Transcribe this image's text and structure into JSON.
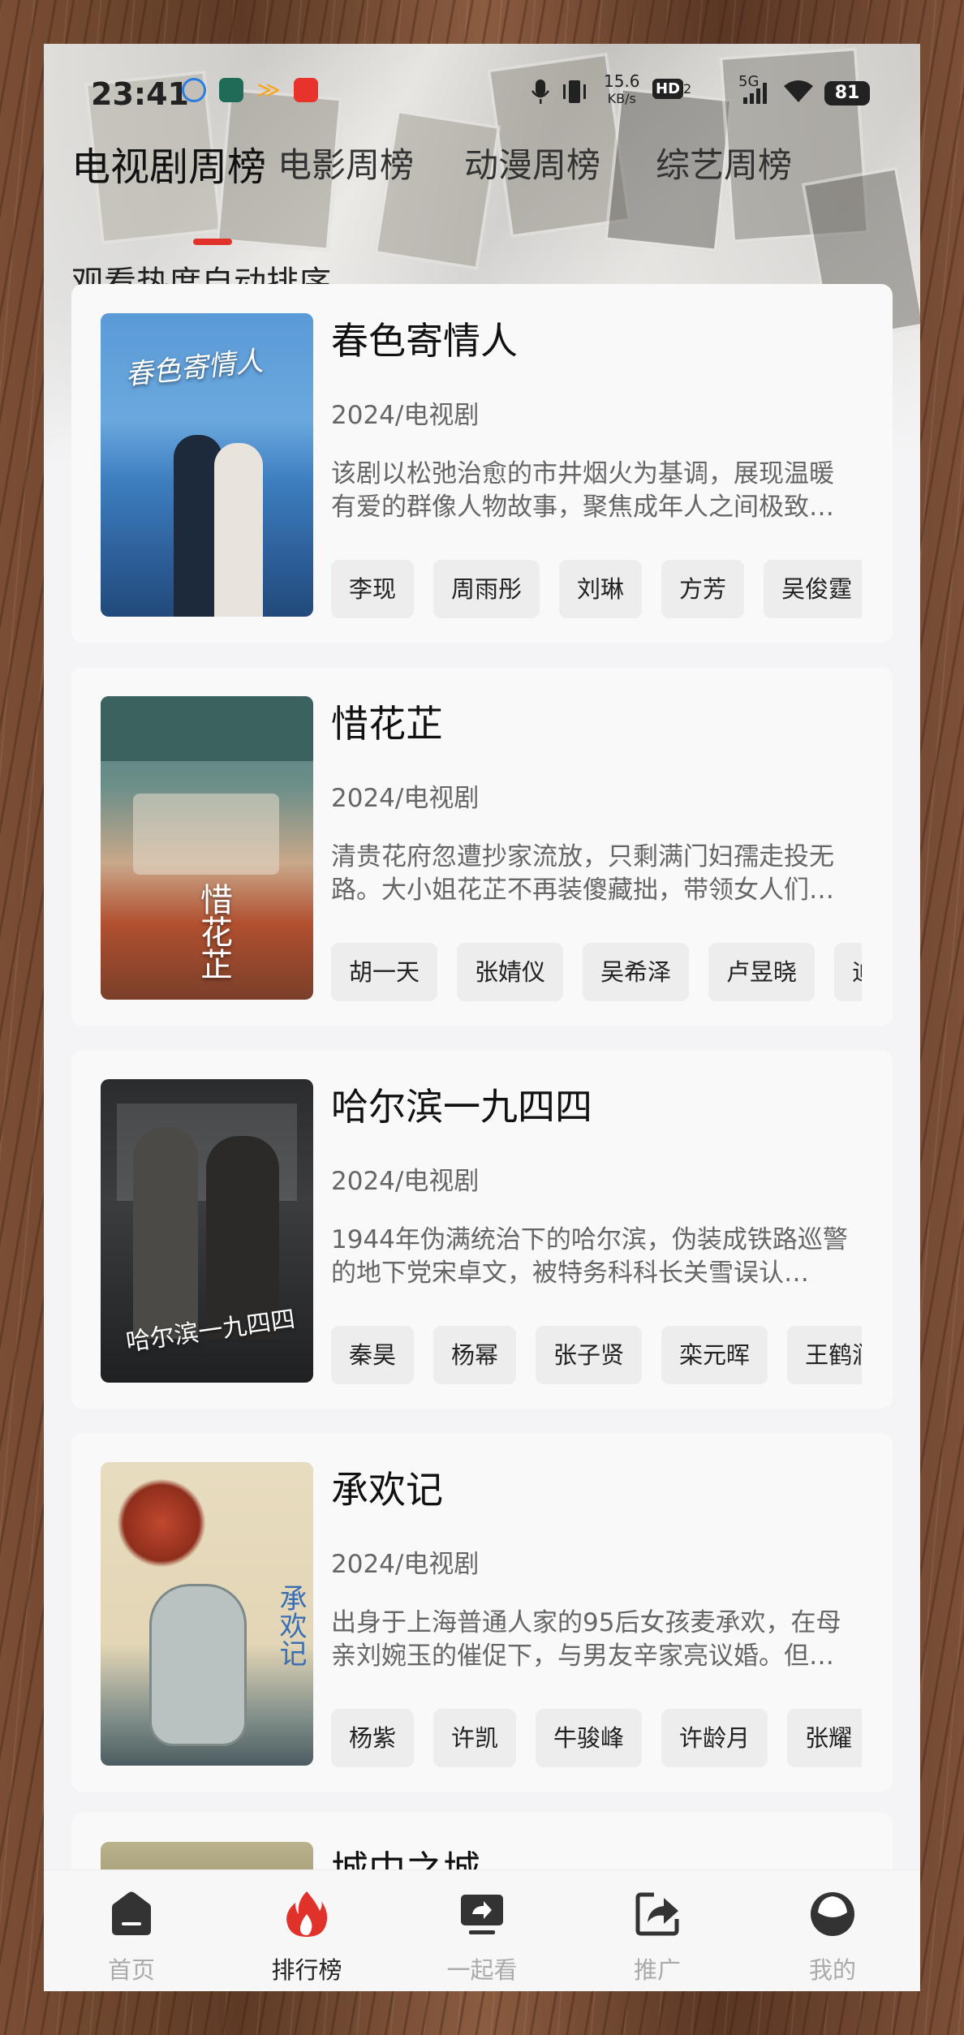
{
  "status_bar": {
    "time": "23:41",
    "net_speed_top": "15.6",
    "net_speed_unit": "KB/s",
    "hd_label": "HD",
    "hd_sub": "2",
    "network": "5G",
    "battery": "81"
  },
  "tabs": [
    {
      "label": "电视剧周榜",
      "active": true
    },
    {
      "label": "电影周榜",
      "active": false
    },
    {
      "label": "动漫周榜",
      "active": false
    },
    {
      "label": "综艺周榜",
      "active": false
    }
  ],
  "subtitle": "观看热度自动排序",
  "items": [
    {
      "title": "春色寄情人",
      "poster_text": "春色寄情人",
      "year_type": "2024/电视剧",
      "description": "该剧以松弛治愈的市井烟火为基调，展现温暖有爱的群像人物故事，聚焦成年人之间极致…",
      "cast": [
        "李现",
        "周雨彤",
        "刘琳",
        "方芳",
        "吴俊霆"
      ]
    },
    {
      "title": "惜花芷",
      "poster_text": "惜花芷",
      "year_type": "2024/电视剧",
      "description": "清贵花府忽遭抄家流放，只剩满门妇孺走投无路。大小姐花芷不再装傻藏拙，带领女人们…",
      "cast": [
        "胡一天",
        "张婧仪",
        "吴希泽",
        "卢昱晓",
        "迪"
      ]
    },
    {
      "title": "哈尔滨一九四四",
      "poster_text": "哈尔滨一九四四",
      "year_type": "2024/电视剧",
      "description": "1944年伪满统治下的哈尔滨，伪装成铁路巡警的地下党宋卓文，被特务科科长关雪误认…",
      "cast": [
        "秦昊",
        "杨幂",
        "张子贤",
        "栾元晖",
        "王鹤润"
      ]
    },
    {
      "title": "承欢记",
      "poster_text": "承欢记",
      "year_type": "2024/电视剧",
      "description": "出身于上海普通人家的95后女孩麦承欢，在母亲刘婉玉的催促下，与男友辛家亮议婚。但…",
      "cast": [
        "杨紫",
        "许凯",
        "牛骏峰",
        "许龄月",
        "张耀"
      ]
    }
  ],
  "peek_item": {
    "title": "城中之城"
  },
  "bottom_nav": [
    {
      "label": "首页",
      "icon": "home-icon",
      "active": false
    },
    {
      "label": "排行榜",
      "icon": "fire-icon",
      "active": true
    },
    {
      "label": "一起看",
      "icon": "screen-share-icon",
      "active": false
    },
    {
      "label": "推广",
      "icon": "share-arrow-icon",
      "active": false
    },
    {
      "label": "我的",
      "icon": "profile-icon",
      "active": false
    }
  ],
  "colors": {
    "accent": "#e0322b",
    "active_icon": "#e0322b",
    "inactive_icon": "#333333"
  }
}
